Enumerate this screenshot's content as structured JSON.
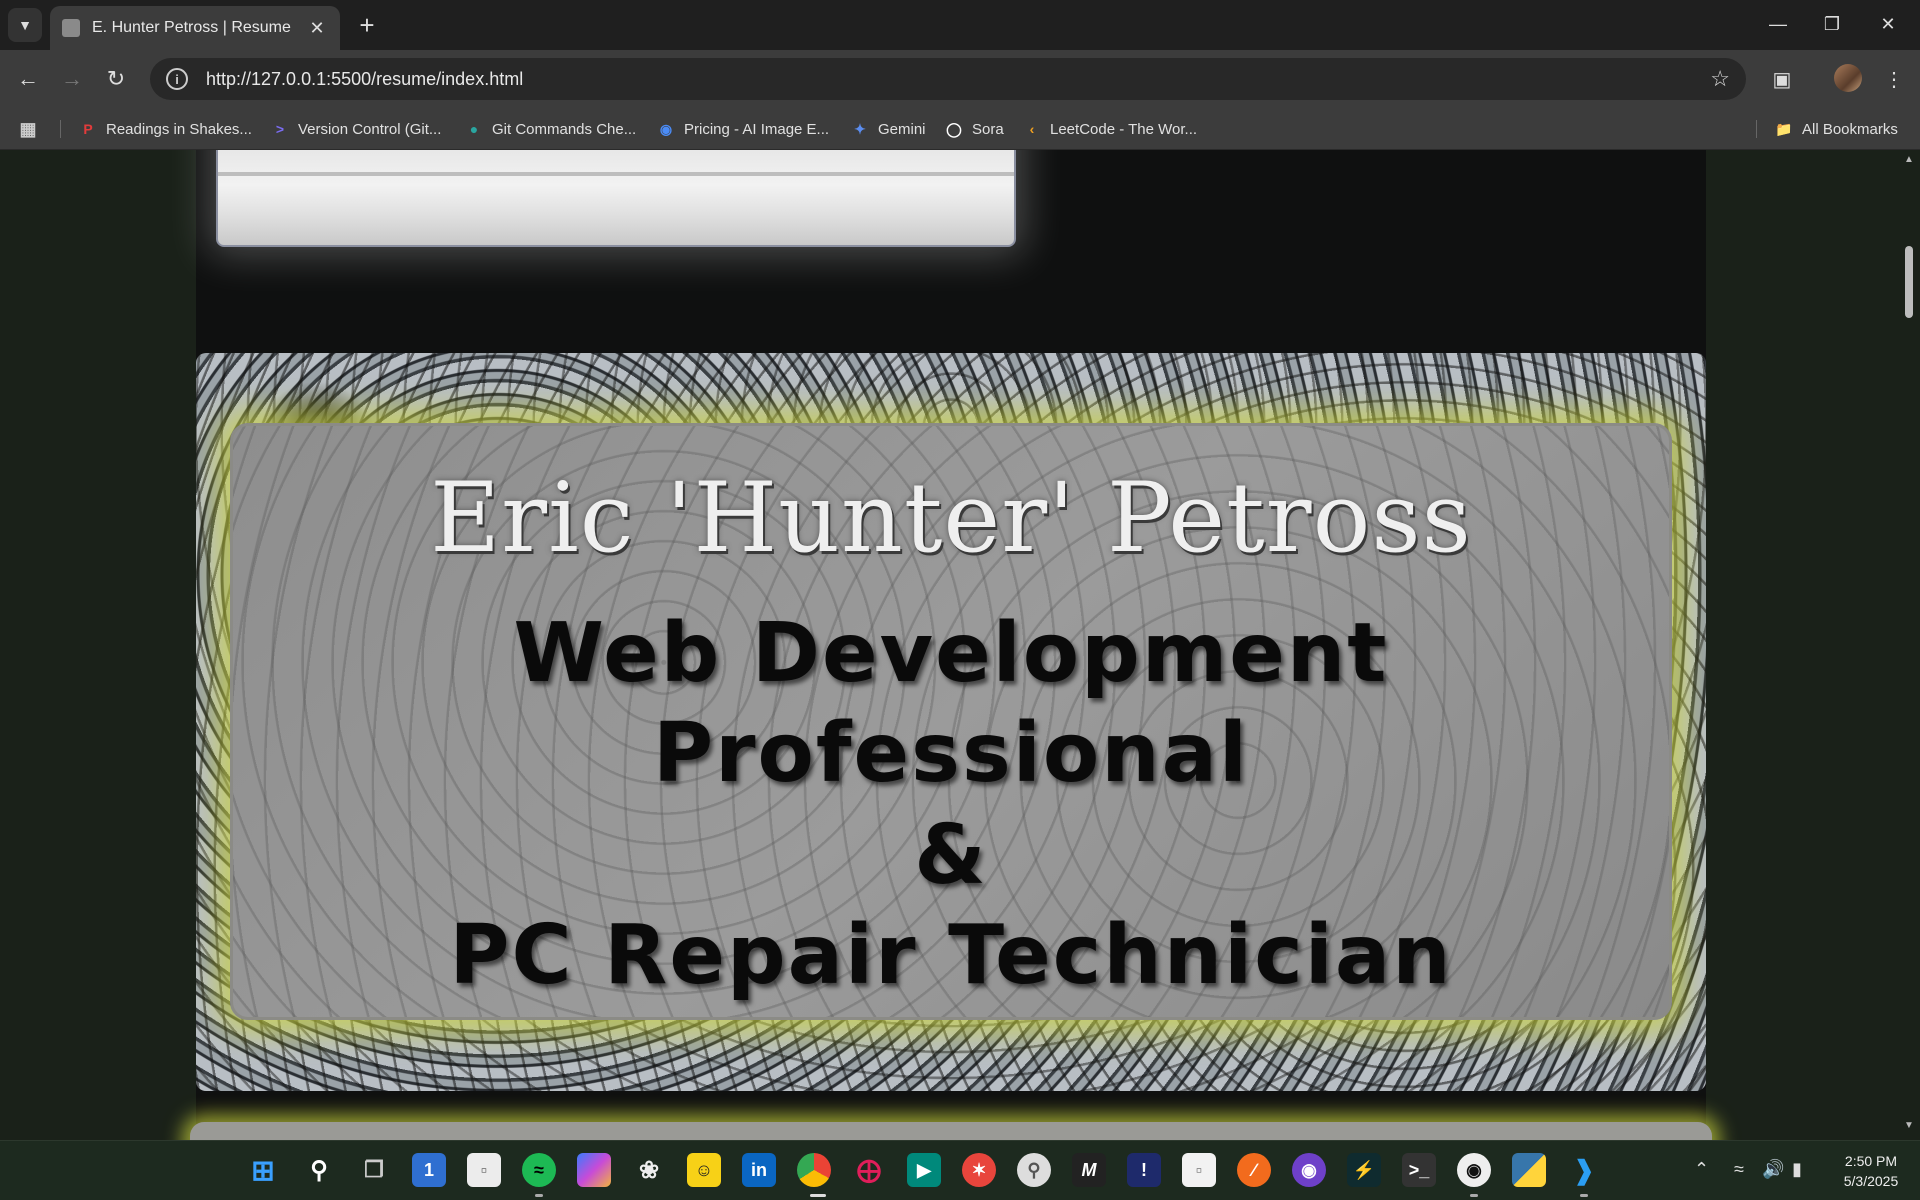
{
  "browser": {
    "tab": {
      "title": "E. Hunter Petross | Resume"
    },
    "url": "http://127.0.0.1:5500/resume/index.html",
    "bookmarks": [
      {
        "label": "Readings in Shakes...",
        "icon": "p-logo-icon",
        "color": "#e23b3b"
      },
      {
        "label": "Version Control (Git...",
        "icon": "arrow-logo-icon",
        "color": "#7a6cf0"
      },
      {
        "label": "Git Commands Che...",
        "icon": "globe-logo-icon",
        "color": "#2aa6a0"
      },
      {
        "label": "Pricing - AI Image E...",
        "icon": "eye-logo-icon",
        "color": "#4b8cf7"
      },
      {
        "label": "Gemini",
        "icon": "sparkle-icon",
        "color": "#5b8def"
      },
      {
        "label": "Sora",
        "icon": "sora-icon",
        "color": "#ffffff"
      },
      {
        "label": "LeetCode - The Wor...",
        "icon": "leetcode-icon",
        "color": "#f0a020"
      }
    ],
    "all_bookmarks_label": "All Bookmarks"
  },
  "hero": {
    "name": "Eric 'Hunter' Petross",
    "lines": [
      "Web Development",
      "Professional",
      "&",
      "PC Repair Technician"
    ],
    "glow_color": "#c8d23c"
  },
  "taskbar": {
    "time": "2:50 PM",
    "date": "5/3/2025",
    "apps": [
      "start-icon",
      "search-icon",
      "task-view-icon",
      "calendar-icon",
      "notepad-icon",
      "spotify-icon",
      "copilot-icon",
      "chatgpt-icon",
      "chat-app-icon",
      "linkedin-icon",
      "chrome-icon",
      "slack-icon",
      "meet-icon",
      "app-red-icon",
      "app-search-icon",
      "app-m-icon",
      "app-info-icon",
      "file-icon",
      "app-orange-icon",
      "github-desktop-icon",
      "app-bolt-icon",
      "terminal-icon",
      "github-icon",
      "python-icon",
      "vscode-icon"
    ]
  }
}
